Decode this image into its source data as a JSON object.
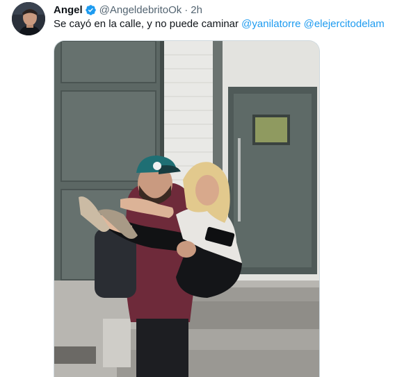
{
  "tweet": {
    "author": {
      "display_name": "Angel",
      "handle": "@AngeldebritoOk",
      "verified": true,
      "verified_icon": "verified-badge-icon",
      "avatar_icon": "avatar-icon"
    },
    "separator": "·",
    "timestamp": "2h",
    "text_before": "Se cayó en la calle, y no puede caminar",
    "mentions": [
      "@yanilatorre",
      "@elejercitodelam"
    ],
    "media": {
      "type": "photo",
      "icon": "photo-icon"
    }
  },
  "colors": {
    "link": "#1d9bf0",
    "text": "#0f1419",
    "secondary": "#536471"
  }
}
